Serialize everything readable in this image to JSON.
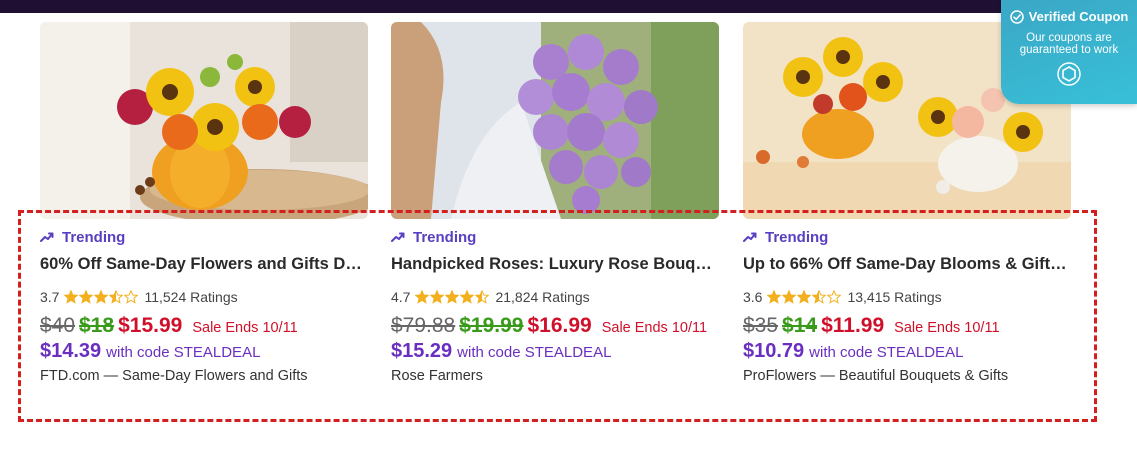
{
  "cards": [
    {
      "trend_label": "Trending",
      "title": "60% Off Same-Day Flowers and Gifts De...",
      "rating": "3.7",
      "stars": 3.7,
      "ratings_count": "11,524 Ratings",
      "orig_price": "$40",
      "prev_price": "$18",
      "sale_price": "$15.99",
      "sale_ends": "Sale Ends 10/11",
      "code_price": "$14.39",
      "code_text": "with code STEALDEAL",
      "store": "FTD.com — Same-Day Flowers and Gifts"
    },
    {
      "trend_label": "Trending",
      "title": "Handpicked Roses: Luxury Rose Bouqu...",
      "rating": "4.7",
      "stars": 4.7,
      "ratings_count": "21,824 Ratings",
      "orig_price": "$79.88",
      "prev_price": "$19.99",
      "sale_price": "$16.99",
      "sale_ends": "Sale Ends 10/11",
      "code_price": "$15.29",
      "code_text": "with code STEALDEAL",
      "store": "Rose Farmers"
    },
    {
      "trend_label": "Trending",
      "title": "Up to 66% Off Same-Day Blooms & Gifts...",
      "rating": "3.6",
      "stars": 3.6,
      "ratings_count": "13,415 Ratings",
      "orig_price": "$35",
      "prev_price": "$14",
      "sale_price": "$11.99",
      "sale_ends": "Sale Ends 10/11",
      "code_price": "$10.79",
      "code_text": "with code STEALDEAL",
      "store": "ProFlowers — Beautiful Bouquets & Gifts"
    }
  ],
  "coupon": {
    "title": "Verified Coupon",
    "subtitle": "Our coupons are guaranteed to work"
  },
  "colors": {
    "accent_purple": "#5a3fc0",
    "sale_red": "#d0102a",
    "prev_green": "#3a9a1a",
    "star_gold": "#f2b01e",
    "highlight_red": "#d41f1f",
    "coupon_teal": "#38b6d0",
    "topbar": "#1f1033"
  }
}
